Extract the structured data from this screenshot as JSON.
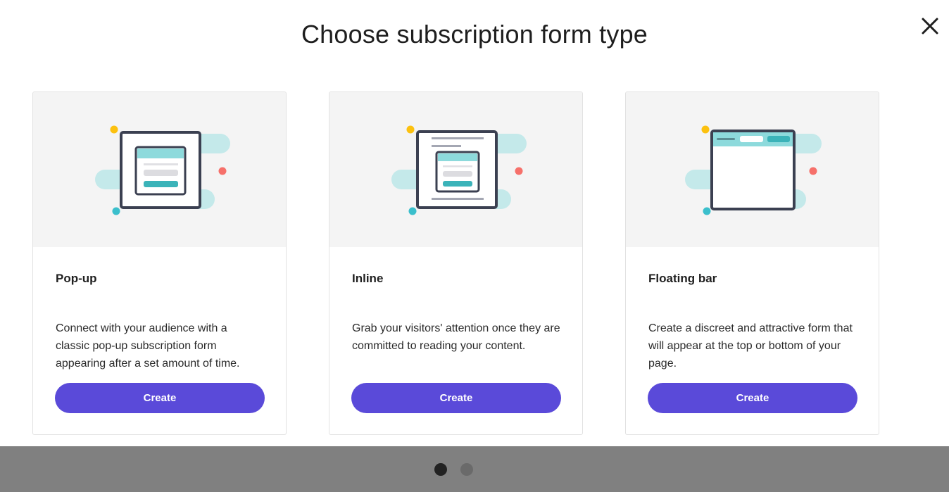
{
  "modal": {
    "title": "Choose subscription form type",
    "close_icon": "close-icon"
  },
  "cards": [
    {
      "name": "Pop-up",
      "description": "Connect with your audience with a classic pop-up subscription form appearing after a set amount of time.",
      "button_label": "Create"
    },
    {
      "name": "Inline",
      "description": "Grab your visitors' attention once they are committed to reading your content.",
      "button_label": "Create"
    },
    {
      "name": "Floating bar",
      "description": "Create a discreet and attractive form that will appear at the top or bottom of your page.",
      "button_label": "Create"
    }
  ],
  "pagination": {
    "pages": 2,
    "current": 1
  },
  "colors": {
    "accent": "#5a4ad9",
    "illustration_bg": "#f4f4f4",
    "teal": "#3bb3b9",
    "teal_light": "#c4e9ea",
    "yellow_dot": "#fcc10f",
    "red_dot": "#f6706a",
    "frame": "#3b4051",
    "overlay": "#808080"
  }
}
